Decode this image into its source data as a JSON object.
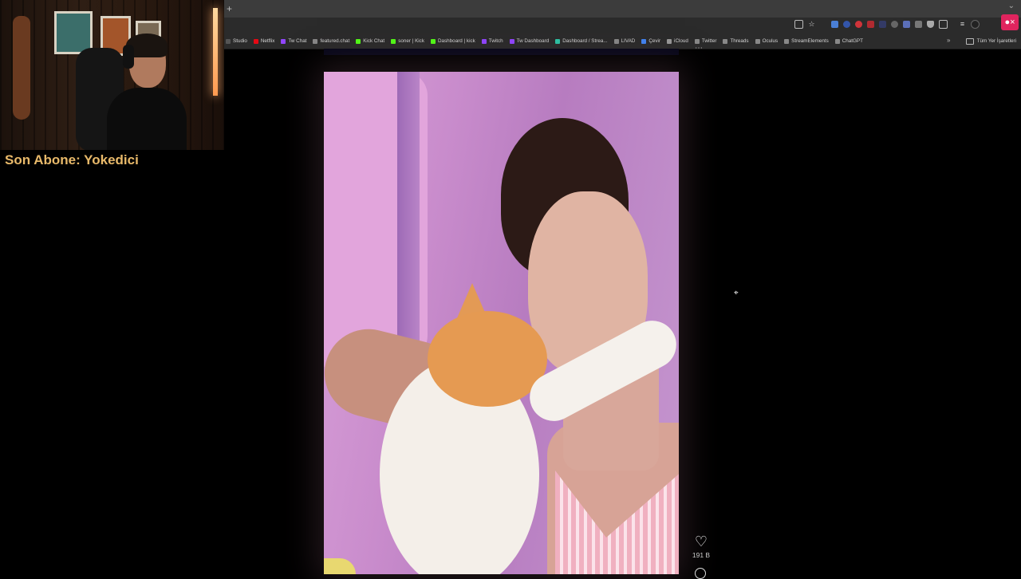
{
  "overlay": {
    "subscriber_text": "Son Abone: Yokedici"
  },
  "browser": {
    "new_tab_symbol": "+",
    "bookmarks": [
      {
        "label": "Studio",
        "color": "#555555"
      },
      {
        "label": "Netflix",
        "color": "#e50914"
      },
      {
        "label": "Tw Chat",
        "color": "#9146ff"
      },
      {
        "label": "featured.chat",
        "color": "#888888"
      },
      {
        "label": "Kick Chat",
        "color": "#53fc18"
      },
      {
        "label": "soner | Kick",
        "color": "#53fc18"
      },
      {
        "label": "Dashboard | kick",
        "color": "#53fc18"
      },
      {
        "label": "Twitch",
        "color": "#9146ff"
      },
      {
        "label": "Tw Dashboard",
        "color": "#9146ff"
      },
      {
        "label": "Dashboard / Strea...",
        "color": "#2ec4a6"
      },
      {
        "label": "LIVAD",
        "color": "#888888"
      },
      {
        "label": "Çevir",
        "color": "#4285f4"
      },
      {
        "label": "iCloud",
        "color": "#999999"
      },
      {
        "label": "Twitter",
        "color": "#888888"
      },
      {
        "label": "Threads",
        "color": "#888888"
      },
      {
        "label": "Oculus",
        "color": "#888888"
      },
      {
        "label": "StreamElements",
        "color": "#888888"
      },
      {
        "label": "ChatGPT",
        "color": "#888888"
      }
    ],
    "more_bookmarks": "»",
    "other_bookmarks": "Tüm Yer İşaretleri",
    "mic_icon": "microphone-icon",
    "accent": "#e0245e"
  },
  "feed": {
    "like_count": "191 B",
    "heart_icon": "♡",
    "menu_icon": "⋯"
  }
}
